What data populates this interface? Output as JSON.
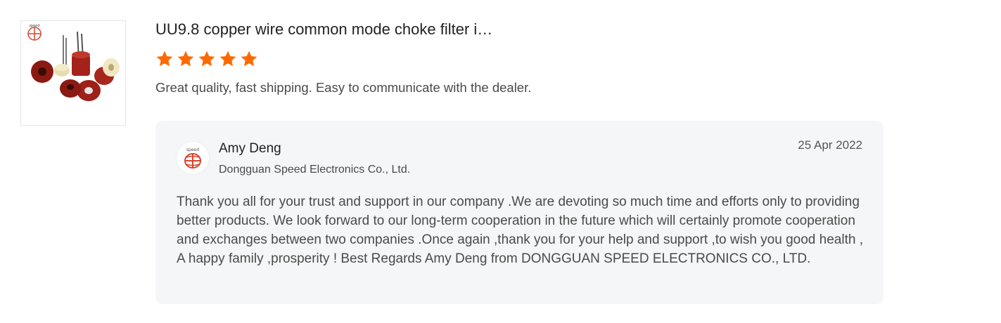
{
  "product": {
    "title": "UU9.8 copper wire common mode choke filter i…",
    "thumbnail_icon": "inductor-product-photo"
  },
  "rating": {
    "stars": 5,
    "max": 5,
    "color": "#ff6a00"
  },
  "review": {
    "text": "Great quality, fast shipping. Easy to communicate with the dealer."
  },
  "reply": {
    "name": "Amy Deng",
    "company": "Dongguan Speed Electronics Co., Ltd.",
    "date": "25 Apr 2022",
    "text": "Thank you all for your trust and support in our company .We are devoting so much time and efforts only to providing better products. We look forward to our long-term cooperation in the future which will certainly promote cooperation and exchanges between two companies .Once again ,thank you for your help and support ,to wish you good health , A happy family ,prosperity !  Best Regards Amy Deng from  DONGGUAN SPEED ELECTRONICS CO., LTD.",
    "avatar_icon": "company-logo-icon"
  },
  "colors": {
    "star": "#ff6a00",
    "reply_background": "#f5f6f7",
    "logo_red": "#d6452b"
  }
}
